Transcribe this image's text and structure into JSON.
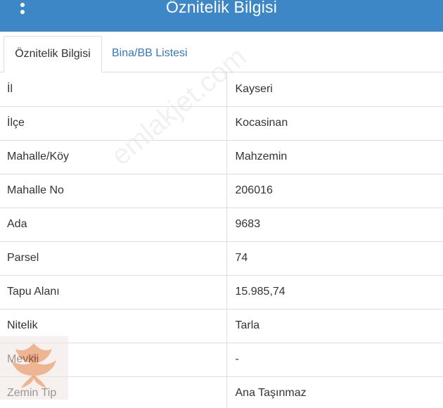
{
  "header": {
    "title": "Öznitelik Bilgisi",
    "menu_icon": "more-vertical-icon",
    "background_color": "#3e87c7"
  },
  "tabs": [
    {
      "label": "Öznitelik Bilgisi",
      "active": true
    },
    {
      "label": "Bina/BB Listesi",
      "active": false
    }
  ],
  "attributes": [
    {
      "key": "İl",
      "value": "Kayseri"
    },
    {
      "key": "İlçe",
      "value": "Kocasinan"
    },
    {
      "key": "Mahalle/Köy",
      "value": "Mahzemin"
    },
    {
      "key": "Mahalle No",
      "value": "206016"
    },
    {
      "key": "Ada",
      "value": "9683"
    },
    {
      "key": "Parsel",
      "value": "74"
    },
    {
      "key": "Tapu Alanı",
      "value": "15.985,74"
    },
    {
      "key": "Nitelik",
      "value": "Tarla"
    },
    {
      "key": "Mevkii",
      "value": "-"
    },
    {
      "key": "Zemin Tip",
      "value": "Ana Taşınmaz"
    }
  ],
  "watermark": {
    "text": "emlakjet.com",
    "logo_icon": "phoenix-logo-icon"
  }
}
